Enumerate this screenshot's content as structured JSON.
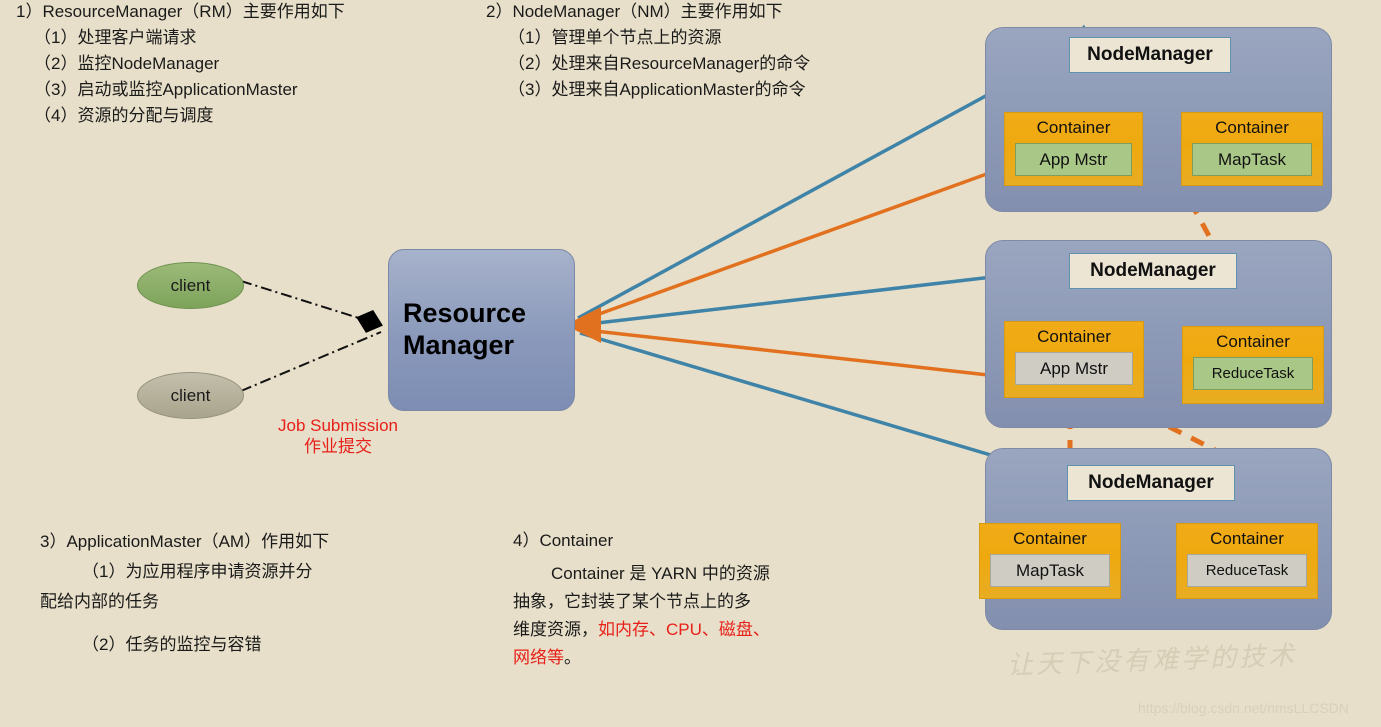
{
  "colors": {
    "background": "#e7dfc9",
    "blue_arrow": "#3f84a8",
    "orange_arrow": "#e2711f",
    "red_text": "#e8201a",
    "node_block": "#8d9ab7",
    "container_orange": "#efa90f",
    "inner_green": "#a9c888",
    "inner_gray": "#cfcdc3",
    "rm_box": "#8a99bb",
    "client_green": "#7da35a",
    "client_gray": "#a9a48c"
  },
  "top_left": {
    "heading": "1）ResourceManager（RM）主要作用如下",
    "items": [
      "（1）处理客户端请求",
      "（2）监控NodeManager",
      "（3）启动或监控ApplicationMaster",
      "（4）资源的分配与调度"
    ]
  },
  "top_right": {
    "heading": "2）NodeManager（NM）主要作用如下",
    "items": [
      "（1）管理单个节点上的资源",
      "（2）处理来自ResourceManager的命令",
      "（3）处理来自ApplicationMaster的命令"
    ]
  },
  "bottom_left": {
    "heading": "3）ApplicationMaster（AM）作用如下",
    "line1": "（1）为应用程序申请资源并分",
    "line2": "配给内部的任务",
    "line3": "（2）任务的监控与容错"
  },
  "bottom_middle": {
    "heading": "4）Container",
    "para_line1": "Container 是 YARN 中的资源",
    "para_line2": "抽象，它封装了某个节点上的多",
    "para_line3_black": "维度资源，",
    "para_line3_red": "如内存、CPU、磁盘、",
    "para_line4_red": "网络等",
    "para_line4_black": "。"
  },
  "clients": [
    {
      "label": "client",
      "color": "green"
    },
    {
      "label": "client",
      "color": "gray"
    }
  ],
  "resource_manager": {
    "line1": "Resource",
    "line2": "Manager"
  },
  "job_submission": {
    "line_en": "Job Submission",
    "line_cn": "作业提交"
  },
  "node_managers": [
    {
      "label": "NodeManager",
      "containers": [
        {
          "title": "Container",
          "inner": "App Mstr",
          "inner_style": "green"
        },
        {
          "title": "Container",
          "inner": "MapTask",
          "inner_style": "green"
        }
      ]
    },
    {
      "label": "NodeManager",
      "containers": [
        {
          "title": "Container",
          "inner": "App Mstr",
          "inner_style": "gray"
        },
        {
          "title": "Container",
          "inner": "ReduceTask",
          "inner_style": "green"
        }
      ]
    },
    {
      "label": "NodeManager",
      "containers": [
        {
          "title": "Container",
          "inner": "MapTask",
          "inner_style": "gray"
        },
        {
          "title": "Container",
          "inner": "ReduceTask",
          "inner_style": "gray"
        }
      ]
    }
  ],
  "watermark": {
    "text": "让天下没有难学的技术",
    "url": "https://blog.csdn.net/nmsLLCSDN"
  }
}
